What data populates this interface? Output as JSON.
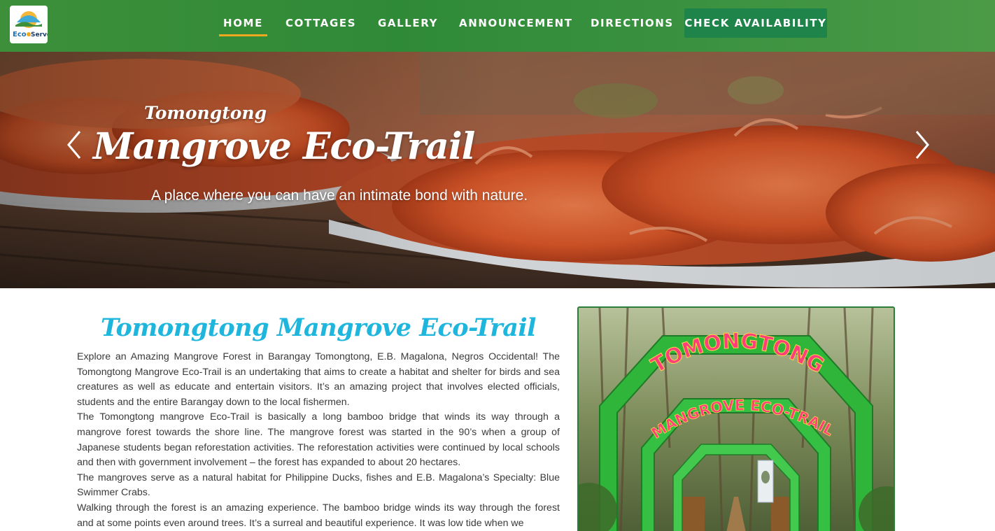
{
  "header": {
    "logo_text_a": "Eco",
    "logo_text_b": "Serve",
    "nav": [
      {
        "label": "HOME",
        "active": true
      },
      {
        "label": "COTTAGES",
        "active": false
      },
      {
        "label": "GALLERY",
        "active": false
      },
      {
        "label": "ANNOUNCEMENT",
        "active": false
      },
      {
        "label": "DIRECTIONS",
        "active": false
      }
    ],
    "cta_label": "CHECK AVAILABILITY",
    "colors": {
      "nav_bg": "#2f8a37",
      "active_underline": "#f0a91e",
      "cta_bg": "#1e8449"
    }
  },
  "hero": {
    "kicker": "Tomongtong",
    "title": "Mangrove Eco-Trail",
    "subtitle": "A place where you can have an intimate bond with nature.",
    "prev_icon": "chevron-left-icon",
    "next_icon": "chevron-right-icon"
  },
  "content": {
    "title": "Tomongtong Mangrove Eco-Trail",
    "title_color": "#1fb6dd",
    "paragraphs": [
      "Explore an Amazing Mangrove Forest in Barangay Tomongtong, E.B. Magalona, Negros Occidental! The Tomongtong Mangrove Eco-Trail is an undertaking that aims to create a habitat and shelter for birds and sea creatures as well as educate and entertain visitors. It’s an amazing project that involves elected officials, students and the entire Barangay down to the local fishermen.",
      "The Tomongtong mangrove Eco-Trail is basically a long bamboo bridge that winds its way through a mangrove forest towards the shore line. The mangrove forest was started in the 90’s when a group of Japanese students began reforestation activities. The reforestation activities were continued by local schools and then with government involvement – the forest has expanded to about 20 hectares.",
      "The mangroves serve as a natural habitat for Philippine Ducks, fishes and E.B. Magalona’s Specialty: Blue Swimmer Crabs.",
      "Walking through the forest is an amazing experience. The bamboo bridge winds its way through the forest and at some points even around trees. It’s a surreal and beautiful experience. It was low tide when we"
    ]
  },
  "photo": {
    "sign_top": "TOMONGTONG",
    "sign_bottom": "MANGROVE ECO-TRAIL"
  }
}
